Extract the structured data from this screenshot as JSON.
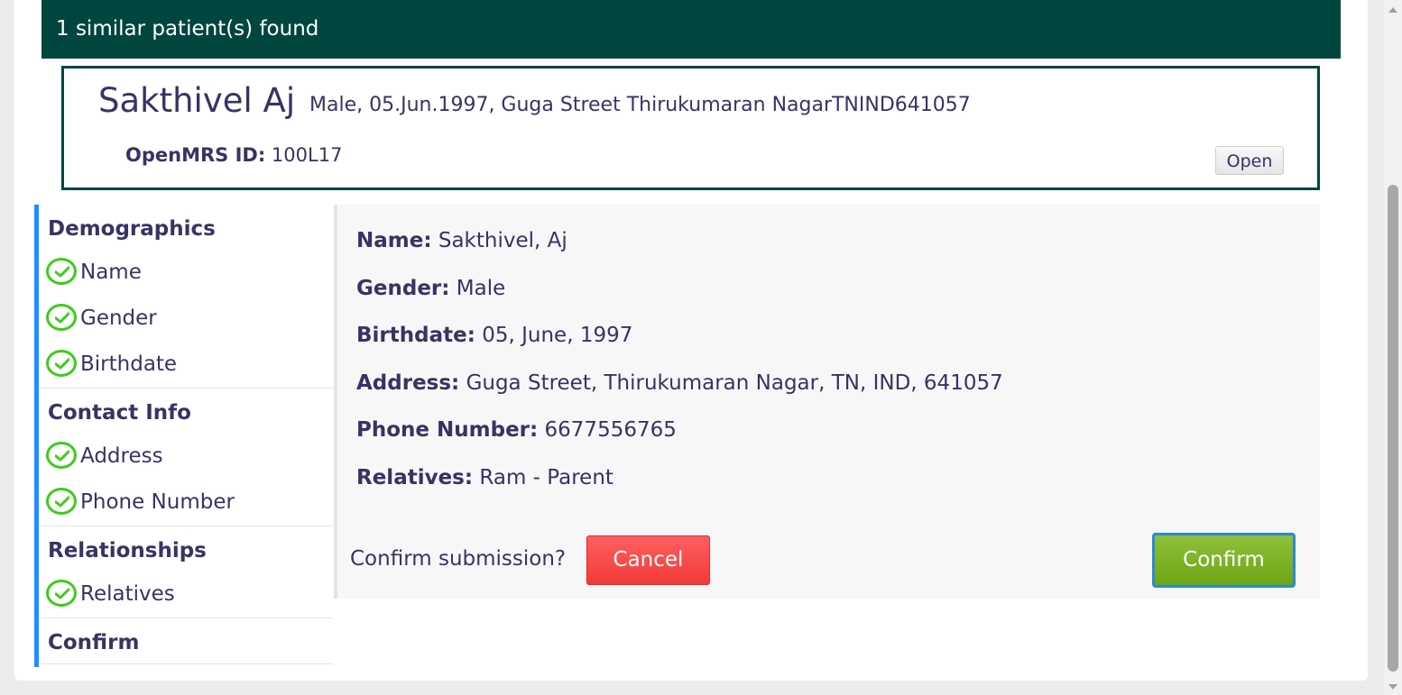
{
  "banner": {
    "text": "1 similar patient(s) found"
  },
  "patient": {
    "name": "Sakthivel Aj",
    "info": "Male, 05.Jun.1997, Guga Street Thirukumaran NagarTNIND641057",
    "id_label": "OpenMRS ID:",
    "id_value": "100L17",
    "open_label": "Open"
  },
  "sidebar": {
    "sections": [
      {
        "title": "Demographics",
        "items": [
          "Name",
          "Gender",
          "Birthdate"
        ]
      },
      {
        "title": "Contact Info",
        "items": [
          "Address",
          "Phone Number"
        ]
      },
      {
        "title": "Relationships",
        "items": [
          "Relatives"
        ]
      },
      {
        "title": "Confirm",
        "items": []
      }
    ]
  },
  "summary": {
    "name_label": "Name:",
    "name_value": "Sakthivel, Aj",
    "gender_label": "Gender:",
    "gender_value": "Male",
    "birthdate_label": "Birthdate:",
    "birthdate_value": "05, June, 1997",
    "address_label": "Address:",
    "address_value": "Guga Street, Thirukumaran Nagar, TN, IND, 641057",
    "phone_label": "Phone Number:",
    "phone_value": "6677556765",
    "relatives_label": "Relatives:",
    "relatives_value": "Ram - Parent"
  },
  "actions": {
    "question": "Confirm submission?",
    "cancel_label": "Cancel",
    "confirm_label": "Confirm"
  },
  "colors": {
    "banner_bg": "#00463f",
    "accent_blue": "#1e90ff",
    "check_green": "#3ccd18",
    "cancel_red": "#f23a3a",
    "confirm_green": "#7db12a"
  }
}
